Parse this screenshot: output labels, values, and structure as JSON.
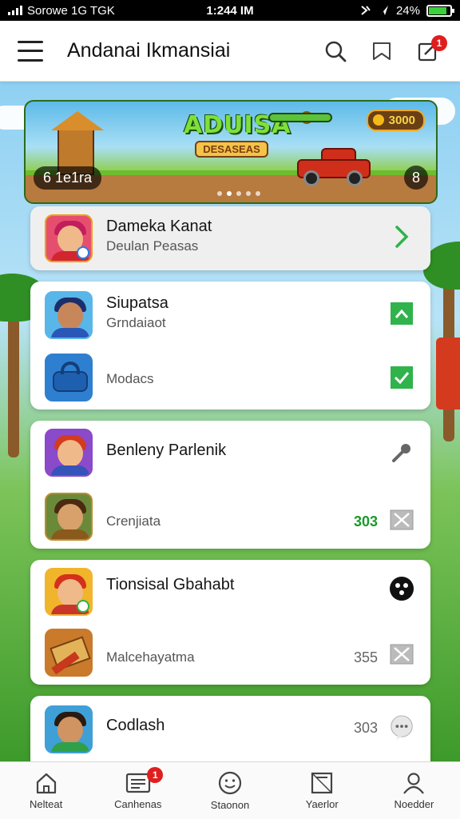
{
  "status_bar": {
    "carrier": "Sorowe 1G  TGK",
    "time": "1:244 IM",
    "battery": "24%",
    "battery_level": 0.85
  },
  "header": {
    "title": "Andanai Ikmansiai",
    "notification_count": "1"
  },
  "banner": {
    "logo_main": "ADUISA",
    "logo_sub": "DESASEAS",
    "score": "3000",
    "left_pill": "6  1e1ra",
    "right_pill": "8",
    "active_slide": 1
  },
  "cards": [
    {
      "rows": [
        {
          "title": "Dameka Kanat",
          "subtitle": "Deulan Peasas",
          "action": "chevron-right"
        }
      ]
    },
    {
      "rows": [
        {
          "title": "Siupatsa",
          "subtitle": "Grndaiaot",
          "action": "flag"
        },
        {
          "title": "",
          "subtitle": "Modacs",
          "action": "check"
        }
      ]
    },
    {
      "rows": [
        {
          "title": "Benleny Parlenik",
          "subtitle": "",
          "action": "microphone"
        },
        {
          "title": "",
          "subtitle": "Crenjiata",
          "number": "303",
          "number_color": "#1a9a2a",
          "action": "close-box"
        }
      ]
    },
    {
      "rows": [
        {
          "title": "Tionsisal Gbahabt",
          "subtitle": "",
          "action": "record"
        },
        {
          "title": "",
          "subtitle": "Malcehayatma",
          "number": "355",
          "number_color": "#666666",
          "action": "close-box"
        }
      ]
    },
    {
      "rows": [
        {
          "title": "Codlash",
          "subtitle": "",
          "number": "303",
          "number_color": "#666666",
          "action": "chat"
        }
      ]
    }
  ],
  "bottom_nav": {
    "items": [
      {
        "label": "Nelteat",
        "icon": "home-icon"
      },
      {
        "label": "Canhenas",
        "icon": "inbox-icon",
        "badge": "1"
      },
      {
        "label": "Staonon",
        "icon": "smile-icon"
      },
      {
        "label": "Yaerlor",
        "icon": "image-icon"
      },
      {
        "label": "Noedder",
        "icon": "profile-icon"
      }
    ]
  },
  "colors": {
    "accent_green": "#2fb34a",
    "badge_red": "#e01e1e"
  }
}
